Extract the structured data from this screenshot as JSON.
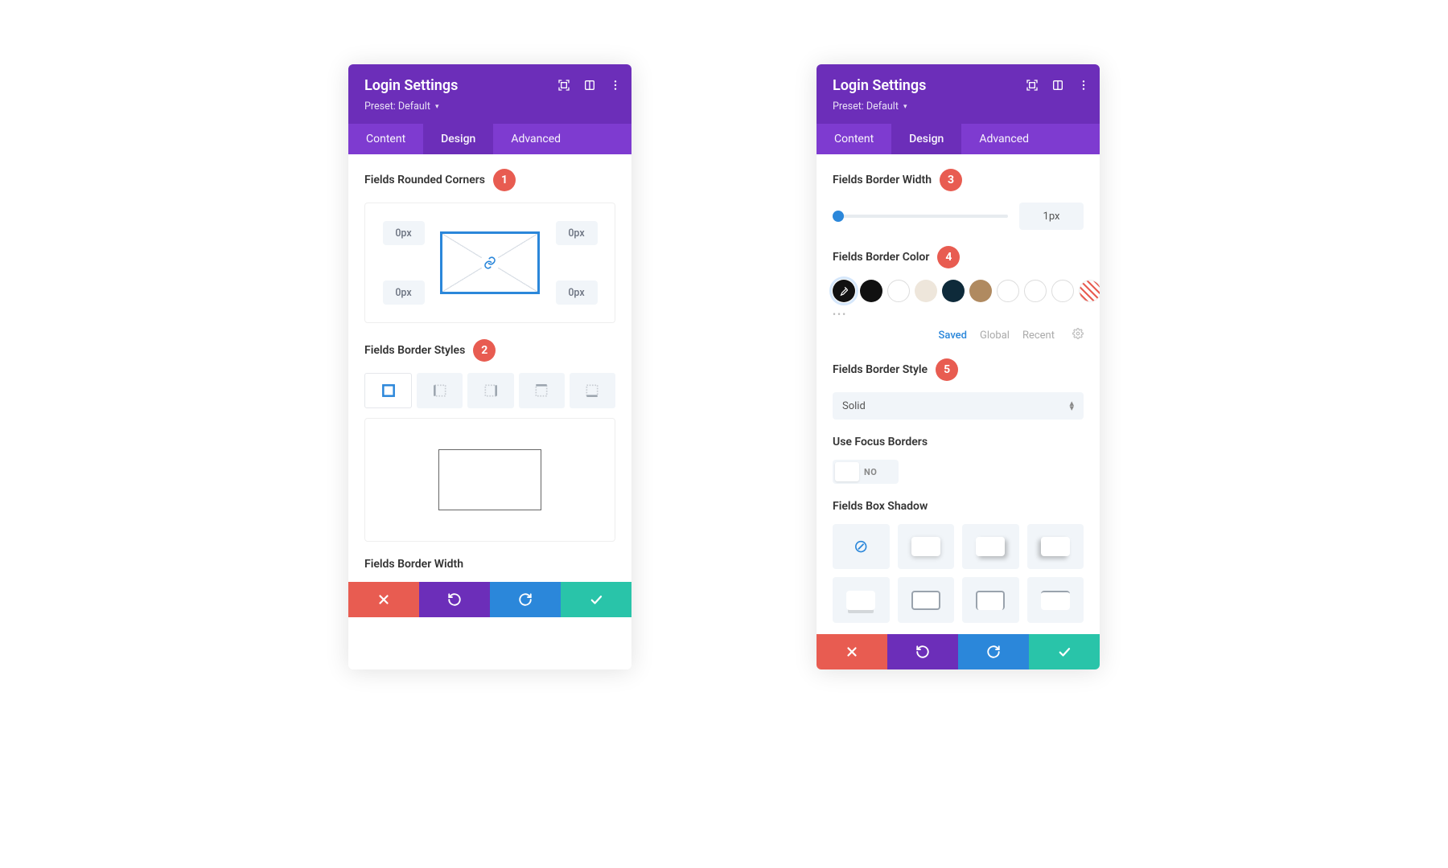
{
  "header": {
    "title": "Login Settings",
    "subtitle": "Preset: Default"
  },
  "tabs": {
    "content": "Content",
    "design": "Design",
    "advanced": "Advanced"
  },
  "left": {
    "rounded_label": "Fields Rounded Corners",
    "corners": {
      "tl": "0px",
      "tr": "0px",
      "bl": "0px",
      "br": "0px"
    },
    "styles_label": "Fields Border Styles",
    "border_width_bottom": "Fields Border Width"
  },
  "right": {
    "width_label": "Fields Border Width",
    "width_value": "1px",
    "color_label": "Fields Border Color",
    "color_tabs": {
      "saved": "Saved",
      "global": "Global",
      "recent": "Recent"
    },
    "style_label": "Fields Border Style",
    "style_value": "Solid",
    "focus_label": "Use Focus Borders",
    "focus_value": "NO",
    "shadow_label": "Fields Box Shadow"
  },
  "badges": {
    "b1": "1",
    "b2": "2",
    "b3": "3",
    "b4": "4",
    "b5": "5"
  },
  "colors": {
    "swatches": [
      "#111111",
      "#111111",
      "#f4efe7",
      "#0e2a3a",
      "#b08a60",
      "#ffffff",
      "#ffffff",
      "#ffffff"
    ]
  }
}
